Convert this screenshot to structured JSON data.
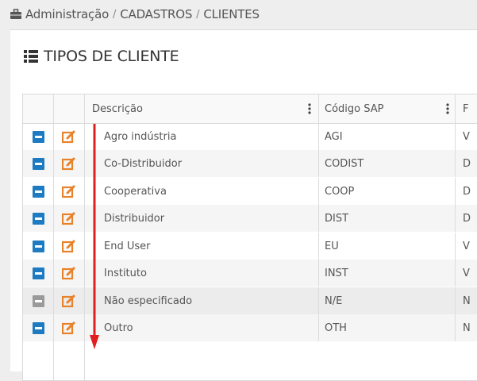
{
  "breadcrumb": {
    "root": "Administração",
    "separator": "/",
    "level1": "CADASTROS",
    "level2": "CLIENTES"
  },
  "panel": {
    "title": "TIPOS DE CLIENTE"
  },
  "table": {
    "columns": {
      "description": "Descrição",
      "sap_code": "Código SAP",
      "next_partial": "F"
    },
    "rows": [
      {
        "description": "Agro indústria",
        "sap_code": "AGI",
        "next_partial": "V",
        "active": true
      },
      {
        "description": "Co-Distribuidor",
        "sap_code": "CODIST",
        "next_partial": "D",
        "active": true
      },
      {
        "description": "Cooperativa",
        "sap_code": "COOP",
        "next_partial": "D",
        "active": true
      },
      {
        "description": "Distribuidor",
        "sap_code": "DIST",
        "next_partial": "D",
        "active": true
      },
      {
        "description": "End User",
        "sap_code": "EU",
        "next_partial": "V",
        "active": true
      },
      {
        "description": "Instituto",
        "sap_code": "INST",
        "next_partial": "V",
        "active": true
      },
      {
        "description": "Não especificado",
        "sap_code": "N/E",
        "next_partial": "N",
        "active": false
      },
      {
        "description": "Outro",
        "sap_code": "OTH",
        "next_partial": "N",
        "active": true
      }
    ]
  },
  "colors": {
    "toggle_active": "#1e7bc2",
    "toggle_inactive": "#9a9a9a",
    "edit_icon": "#e8822a",
    "annotation_arrow": "#e02020"
  },
  "icons": {
    "breadcrumb": "briefcase-icon",
    "title": "list-icon",
    "toggle": "minus-square-icon",
    "edit": "edit-icon",
    "column_menu": "kebab-menu-icon"
  }
}
